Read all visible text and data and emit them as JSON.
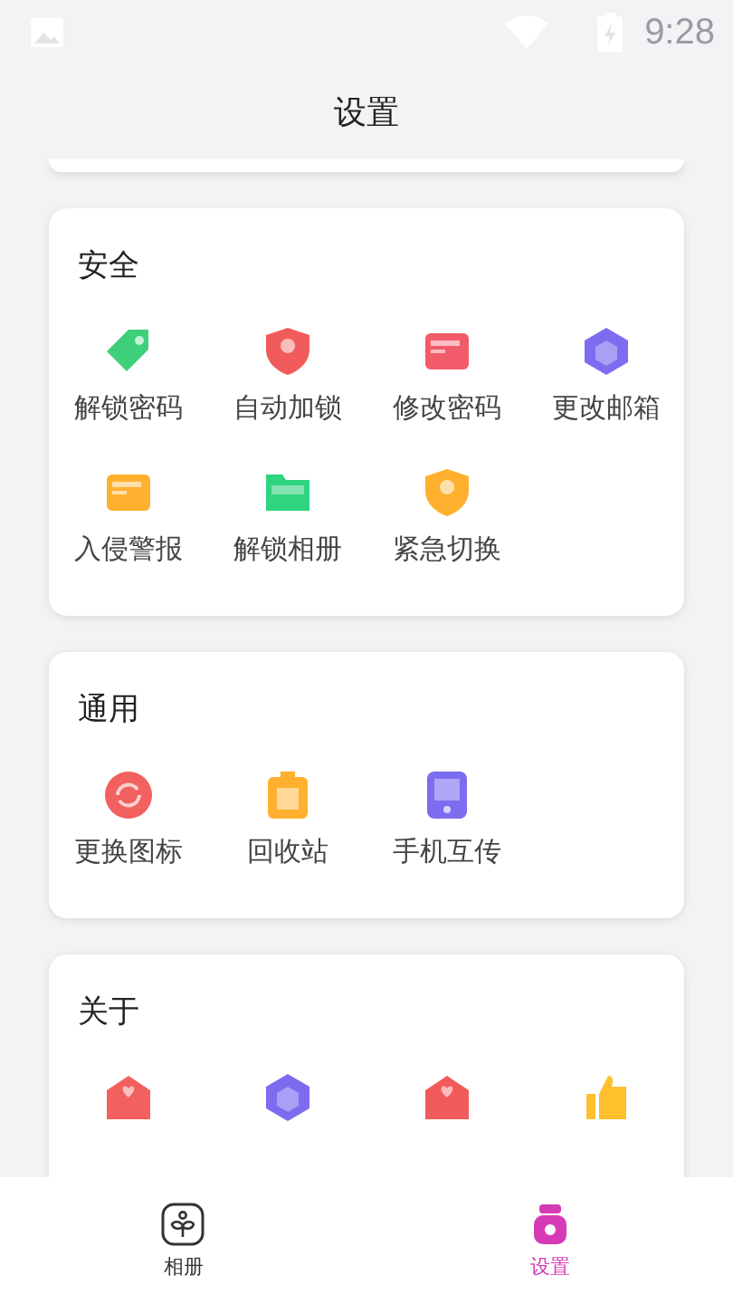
{
  "status_bar": {
    "time": "9:28"
  },
  "header": {
    "title": "设置"
  },
  "sections": [
    {
      "title": "安全",
      "items": [
        {
          "label": "解锁密码"
        },
        {
          "label": "自动加锁"
        },
        {
          "label": "修改密码"
        },
        {
          "label": "更改邮箱"
        },
        {
          "label": "入侵警报"
        },
        {
          "label": "解锁相册"
        },
        {
          "label": "紧急切换"
        }
      ]
    },
    {
      "title": "通用",
      "items": [
        {
          "label": "更换图标"
        },
        {
          "label": "回收站"
        },
        {
          "label": "手机互传"
        }
      ]
    },
    {
      "title": "关于",
      "items": [
        {
          "kind": "icon"
        },
        {
          "kind": "icon"
        },
        {
          "kind": "icon"
        },
        {
          "kind": "icon"
        }
      ]
    }
  ],
  "tabs": [
    {
      "label": "相册",
      "selected": false
    },
    {
      "label": "设置",
      "selected": true
    }
  ]
}
